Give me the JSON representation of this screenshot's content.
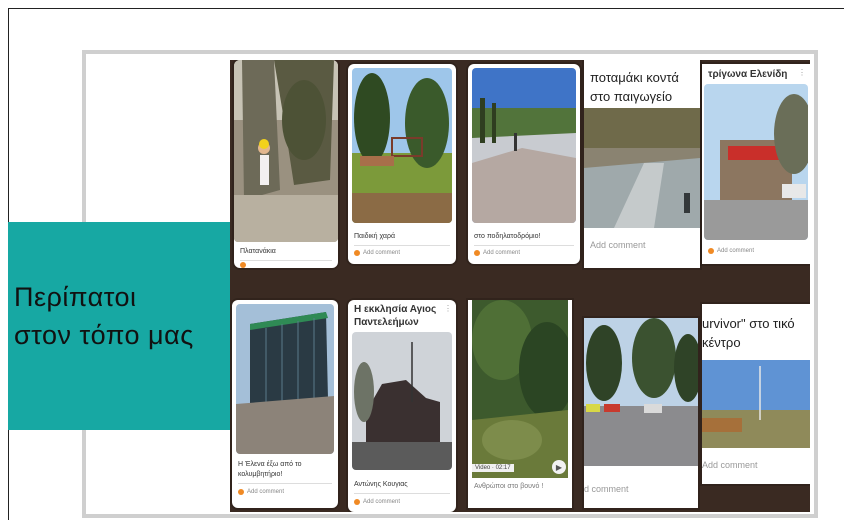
{
  "title": {
    "line1": "Περίπατοι",
    "line2": "στον τόπο μας"
  },
  "cards": {
    "c1": {
      "caption": "Πλατανάκια"
    },
    "c2": {
      "caption": "Παιδική χαρά",
      "add": "Add comment"
    },
    "c3": {
      "caption": "στο ποδηλατοδρόμιο!",
      "add": "Add comment"
    },
    "c4": {
      "heading": "ποταμάκι κοντά στο παιγωγείο μας",
      "add": "Add comment"
    },
    "c5": {
      "heading": "τρίγωνα Ελενίδη",
      "add": "Add comment"
    },
    "c6": {
      "caption": "Η Έλενα έξω από το κολυμβητήριο!",
      "add": "Add comment"
    },
    "c7": {
      "heading": "Η εκκλησία Αγιος Παντελεήμων",
      "caption": "Αντώνης Κουγιας",
      "add": "Add comment"
    },
    "c8": {
      "video": "Video · 02:17",
      "caption": "Ανθρώποι στο βουνό !"
    },
    "c9": {
      "add": "d comment"
    },
    "c10": {
      "heading": "urvivor\" στο τικό κέντρο",
      "add": "Add comment"
    }
  },
  "colors": {
    "title_bg": "#17a8a3",
    "accent": "#f08a24",
    "board_bg": "#3a2a22"
  },
  "icons": [
    "more-options-icon",
    "play-icon",
    "comment-avatar-icon"
  ]
}
